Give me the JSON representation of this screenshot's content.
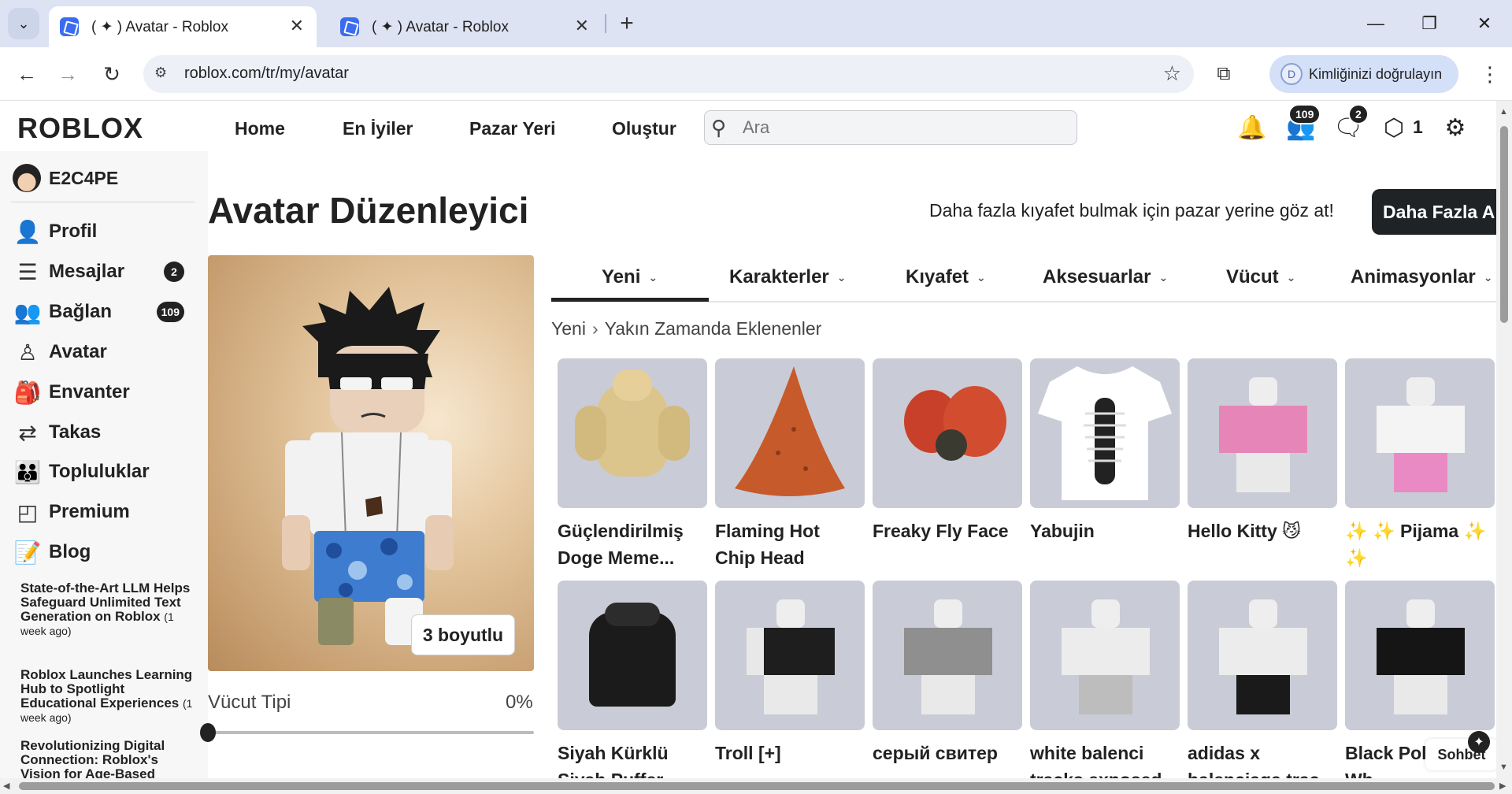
{
  "browser": {
    "tabs": [
      {
        "title": "( ✦ ) Avatar - Roblox",
        "active": true
      },
      {
        "title": "( ✦ ) Avatar - Roblox",
        "active": false
      }
    ],
    "url": "roblox.com/tr/my/avatar",
    "verify_label": "Kimliğinizi doğrulayın",
    "verify_initial": "D"
  },
  "header": {
    "logo": "ROBLOX",
    "nav": [
      "Home",
      "En İyiler",
      "Pazar Yeri",
      "Oluştur"
    ],
    "search_placeholder": "Ara",
    "friends_badge": "109",
    "messages_badge": "2",
    "robux_count": "1"
  },
  "sidebar": {
    "username": "E2C4PE",
    "items": [
      {
        "label": "Profil",
        "icon": "person-icon"
      },
      {
        "label": "Mesajlar",
        "icon": "messages-icon",
        "badge": "2"
      },
      {
        "label": "Bağlan",
        "icon": "friends-icon",
        "badge": "109"
      },
      {
        "label": "Avatar",
        "icon": "avatar-icon"
      },
      {
        "label": "Envanter",
        "icon": "inventory-icon"
      },
      {
        "label": "Takas",
        "icon": "trade-icon"
      },
      {
        "label": "Topluluklar",
        "icon": "groups-icon"
      },
      {
        "label": "Premium",
        "icon": "premium-icon"
      },
      {
        "label": "Blog",
        "icon": "blog-icon"
      }
    ],
    "blog": [
      {
        "title": "State-of-the-Art LLM Helps Safeguard Unlimited Text Generation on Roblox",
        "ago": "(1 week ago)"
      },
      {
        "title": "Roblox Launches Learning Hub to Spotlight Educational Experiences",
        "ago": "(1 week ago)"
      },
      {
        "title": "Revolutionizing Digital Connection: Roblox's Vision for Age-Based",
        "ago": ""
      }
    ]
  },
  "main": {
    "title": "Avatar Düzenleyici",
    "promo_text": "Daha fazla kıyafet bulmak için pazar yerine göz at!",
    "promo_button": "Daha Fazla A",
    "view_toggle": "3 boyutlu",
    "body_type_label": "Vücut Tipi",
    "body_type_value": "0%",
    "body_type_fraction": 0,
    "tabs": [
      "Yeni",
      "Karakterler",
      "Kıyafet",
      "Aksesuarlar",
      "Vücut",
      "Animasyonlar"
    ],
    "breadcrumb": [
      "Yeni",
      "Yakın Zamanda Eklenenler"
    ],
    "items": [
      {
        "name": "Güçlendirilmiş Doge Meme...",
        "thumb": "doge-icon"
      },
      {
        "name": "Flaming Hot Chip Head",
        "thumb": "chip-icon"
      },
      {
        "name": "Freaky Fly Face",
        "thumb": "fly-icon"
      },
      {
        "name": "Yabujin",
        "thumb": "tshirt-icon"
      },
      {
        "name": "Hello Kitty 😼",
        "thumb": "outfit-pink-icon"
      },
      {
        "name": "✨ ✨ Pijama ✨ ✨",
        "thumb": "outfit-pajama-icon"
      },
      {
        "name": "Siyah Kürklü Siyah Puffer",
        "thumb": "puffer-icon"
      },
      {
        "name": "Troll [+]",
        "thumb": "outfit-black-icon"
      },
      {
        "name": "серый свитер",
        "thumb": "outfit-grey-icon"
      },
      {
        "name": "white balenci tracks exposed",
        "thumb": "outfit-white-icon"
      },
      {
        "name": "adidas x balenciaga trac",
        "thumb": "outfit-adidas-icon"
      },
      {
        "name": "Black Pol Up w Wh",
        "thumb": "outfit-polo-icon"
      }
    ],
    "chat_label": "Sohbet"
  }
}
